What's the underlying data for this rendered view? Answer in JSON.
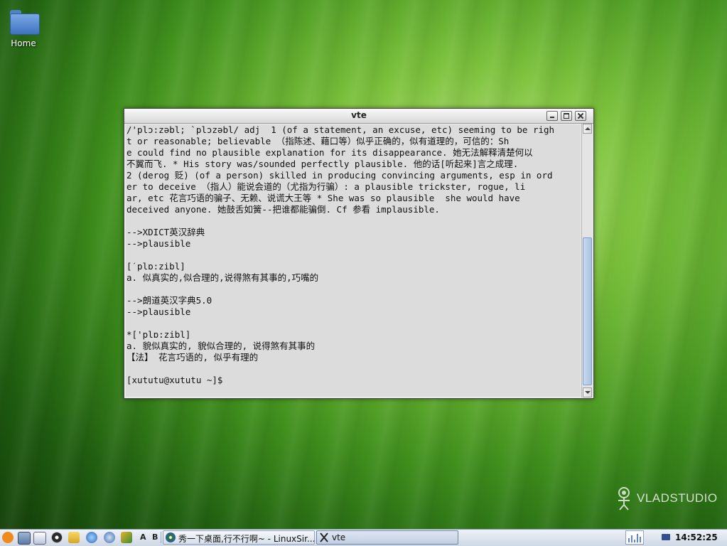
{
  "desktop": {
    "icons": [
      {
        "label": "Home",
        "icon": "folder-icon"
      }
    ]
  },
  "window": {
    "title": "vte",
    "buttons": [
      "minimize-icon",
      "maximize-icon",
      "close-icon"
    ]
  },
  "terminal": {
    "lines": [
      "/'plɔ:zəbl; `plɔzəbl/ adj  1 (of a statement, an excuse, etc) seeming to be righ",
      "t or reasonable; believable （指陈述、藉口等）似乎正确的，似有道理的，可信的：Sh",
      "e could find no plausible explanation for its disappearance. 她无法解释清楚何以",
      "不翼而飞. * His story was/sounded perfectly plausible. 他的话[听起来]言之成理.",
      "2 (derog 贬) (of a person) skilled in producing convincing arguments, esp in ord",
      "er to deceive （指人）能说会道的（尤指为行骗）: a plausible trickster, rogue, li",
      "ar, etc 花言巧语的骗子、无赖、说谎大王等 * She was so plausible  she would have",
      "deceived anyone. 她鼓舌如簧--把谁都能骗倒. Cf 参看 implausible.",
      "",
      "-->XDICT英汉辞典",
      "-->plausible",
      "",
      "[ˊplɒ:zibl]",
      "a. 似真实的,似合理的,说得煞有其事的,巧嘴的",
      "",
      "-->朗道英汉字典5.0",
      "-->plausible",
      "",
      "*['plɒ:zibl]",
      "a. 貌似真实的, 貌似合理的, 说得煞有其事的",
      "【法】 花言巧语的, 似乎有理的",
      "",
      "[xututu@xututu ~]$"
    ]
  },
  "watermark": {
    "text": "VLADSTUDIO"
  },
  "taskbar": {
    "launchers": [
      "menu-icon",
      "screen-icon",
      "windows-icon",
      "browser-icon",
      "folder-icon",
      "network-icon",
      "settings-icon",
      "paint-icon"
    ],
    "letters": [
      "A",
      "B"
    ],
    "tasks": [
      {
        "label": "秀一下桌面,行不行啊~ - LinuxSir...",
        "icon": "browser-icon",
        "active": false
      },
      {
        "label": "vte",
        "icon": "x-icon",
        "active": true
      }
    ],
    "clock": "14:52:25"
  }
}
